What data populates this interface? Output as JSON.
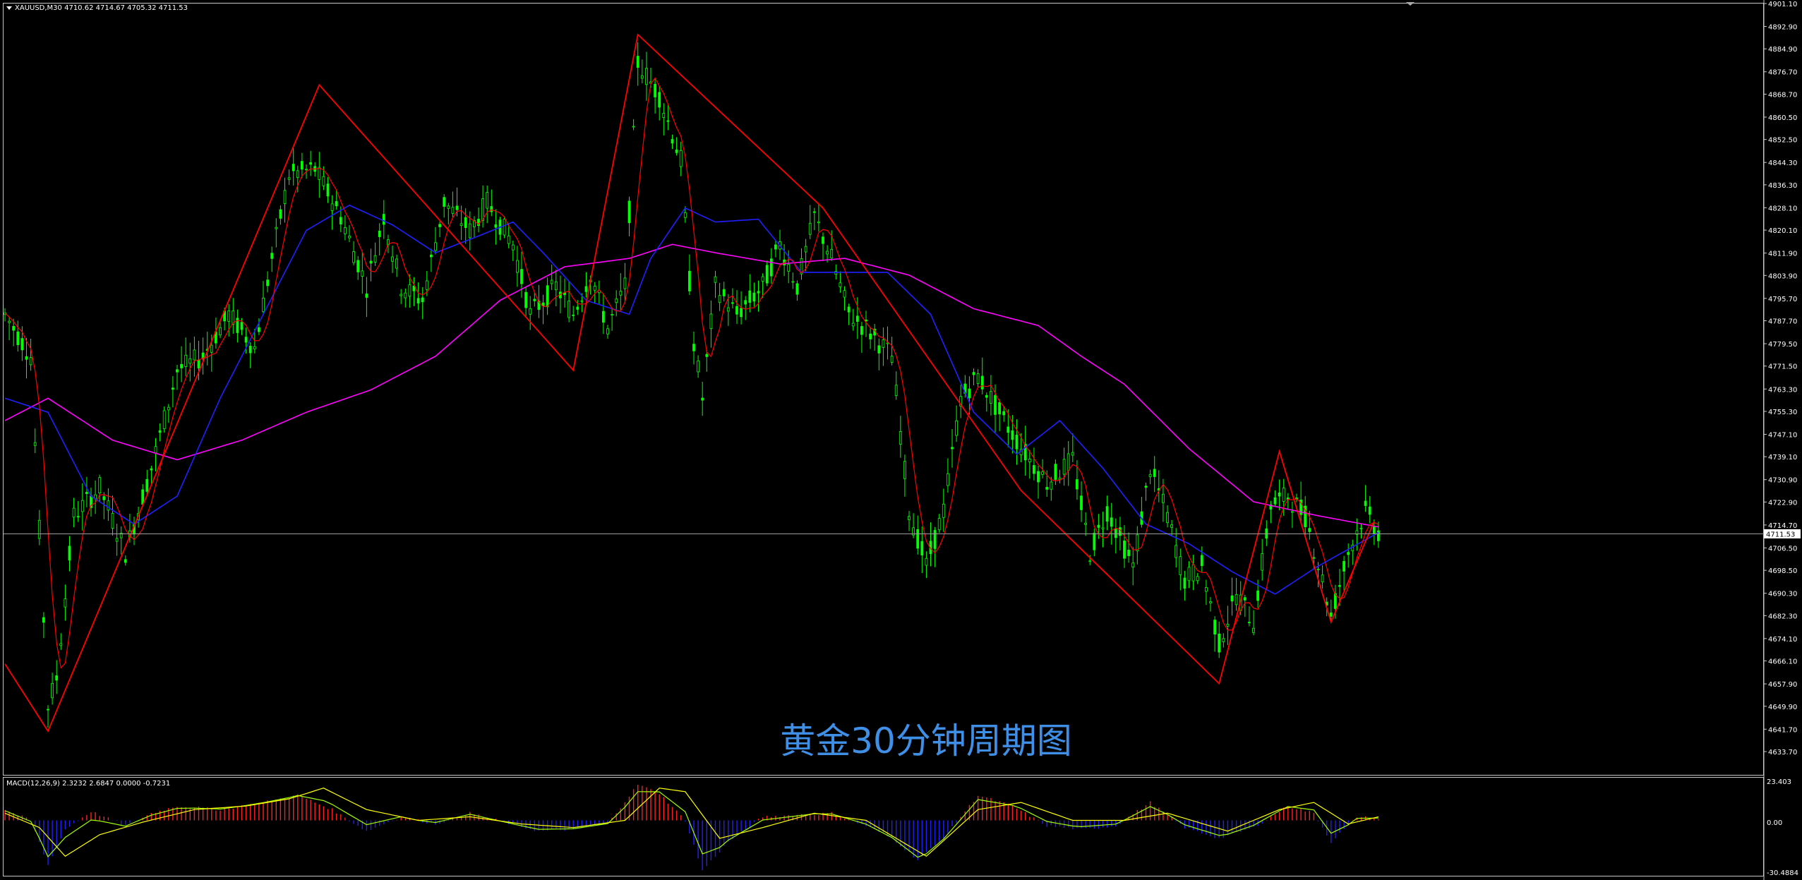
{
  "header": {
    "symbol_info": "XAUUSD,M30  4710.62 4714.67 4705.32 4711.53"
  },
  "caption": "黄金30分钟周期图",
  "current_price_label": "4711.53",
  "macd": {
    "label": "MACD(12,26,9) 2.3232 2.6847 0.0000 -0.7231",
    "axis_labels": [
      "23.403",
      "0.00",
      "-30.4884"
    ]
  },
  "colors": {
    "background": "#000000",
    "grid_frame": "#c8c8c8",
    "candle": "#00ff00",
    "ma_fast": "#ff0000",
    "ma_mid": "#2020ff",
    "ma_slow": "#ff00ff",
    "zigzag": "#ff0000",
    "macd_pos": "#ff2020",
    "macd_neg": "#2020ff",
    "macd_line": "#a0ff00",
    "macd_signal": "#ffff00",
    "caption": "#3f8fe6"
  },
  "chart_data": [
    {
      "type": "candlestick",
      "y_tick_labels": [
        "4901.10",
        "4892.90",
        "4884.90",
        "4876.70",
        "4868.70",
        "4860.50",
        "4852.50",
        "4844.30",
        "4836.30",
        "4828.10",
        "4820.10",
        "4811.90",
        "4803.90",
        "4795.70",
        "4787.70",
        "4779.50",
        "4771.50",
        "4763.30",
        "4755.30",
        "4747.10",
        "4739.10",
        "4730.90",
        "4722.90",
        "4714.70",
        "4706.50",
        "4698.50",
        "4690.30",
        "4682.30",
        "4674.10",
        "4666.10",
        "4657.90",
        "4649.90",
        "4641.70",
        "4633.70"
      ],
      "ylim": [
        4633.7,
        4901.1
      ],
      "current_price": 4711.53,
      "bars": 320,
      "zigzag": [
        {
          "i": 0,
          "p": 4665
        },
        {
          "i": 10,
          "p": 4641
        },
        {
          "i": 73,
          "p": 4872
        },
        {
          "i": 132,
          "p": 4770
        },
        {
          "i": 147,
          "p": 4890
        },
        {
          "i": 190,
          "p": 4828
        },
        {
          "i": 236,
          "p": 4727
        },
        {
          "i": 282,
          "p": 4658
        },
        {
          "i": 296,
          "p": 4741
        },
        {
          "i": 308,
          "p": 4680
        },
        {
          "i": 318,
          "p": 4716
        }
      ],
      "price_path": [
        {
          "i": 0,
          "p": 4790
        },
        {
          "i": 6,
          "p": 4775
        },
        {
          "i": 10,
          "p": 4650
        },
        {
          "i": 12,
          "p": 4660
        },
        {
          "i": 16,
          "p": 4718
        },
        {
          "i": 22,
          "p": 4728
        },
        {
          "i": 28,
          "p": 4705
        },
        {
          "i": 34,
          "p": 4735
        },
        {
          "i": 40,
          "p": 4770
        },
        {
          "i": 46,
          "p": 4775
        },
        {
          "i": 52,
          "p": 4790
        },
        {
          "i": 58,
          "p": 4778
        },
        {
          "i": 62,
          "p": 4810
        },
        {
          "i": 66,
          "p": 4840
        },
        {
          "i": 72,
          "p": 4842
        },
        {
          "i": 78,
          "p": 4825
        },
        {
          "i": 84,
          "p": 4800
        },
        {
          "i": 88,
          "p": 4825
        },
        {
          "i": 92,
          "p": 4800
        },
        {
          "i": 97,
          "p": 4795
        },
        {
          "i": 102,
          "p": 4830
        },
        {
          "i": 108,
          "p": 4820
        },
        {
          "i": 112,
          "p": 4830
        },
        {
          "i": 118,
          "p": 4815
        },
        {
          "i": 122,
          "p": 4790
        },
        {
          "i": 128,
          "p": 4800
        },
        {
          "i": 132,
          "p": 4790
        },
        {
          "i": 136,
          "p": 4805
        },
        {
          "i": 140,
          "p": 4785
        },
        {
          "i": 144,
          "p": 4800
        },
        {
          "i": 147,
          "p": 4880
        },
        {
          "i": 152,
          "p": 4868
        },
        {
          "i": 157,
          "p": 4845
        },
        {
          "i": 160,
          "p": 4780
        },
        {
          "i": 162,
          "p": 4760
        },
        {
          "i": 165,
          "p": 4800
        },
        {
          "i": 170,
          "p": 4790
        },
        {
          "i": 176,
          "p": 4800
        },
        {
          "i": 180,
          "p": 4815
        },
        {
          "i": 184,
          "p": 4800
        },
        {
          "i": 188,
          "p": 4825
        },
        {
          "i": 192,
          "p": 4810
        },
        {
          "i": 196,
          "p": 4790
        },
        {
          "i": 200,
          "p": 4785
        },
        {
          "i": 206,
          "p": 4775
        },
        {
          "i": 210,
          "p": 4720
        },
        {
          "i": 214,
          "p": 4700
        },
        {
          "i": 218,
          "p": 4720
        },
        {
          "i": 222,
          "p": 4760
        },
        {
          "i": 226,
          "p": 4768
        },
        {
          "i": 232,
          "p": 4752
        },
        {
          "i": 238,
          "p": 4738
        },
        {
          "i": 242,
          "p": 4730
        },
        {
          "i": 248,
          "p": 4738
        },
        {
          "i": 252,
          "p": 4705
        },
        {
          "i": 256,
          "p": 4720
        },
        {
          "i": 262,
          "p": 4700
        },
        {
          "i": 266,
          "p": 4735
        },
        {
          "i": 270,
          "p": 4718
        },
        {
          "i": 274,
          "p": 4695
        },
        {
          "i": 278,
          "p": 4700
        },
        {
          "i": 282,
          "p": 4672
        },
        {
          "i": 286,
          "p": 4690
        },
        {
          "i": 290,
          "p": 4680
        },
        {
          "i": 294,
          "p": 4722
        },
        {
          "i": 298,
          "p": 4725
        },
        {
          "i": 302,
          "p": 4718
        },
        {
          "i": 306,
          "p": 4695
        },
        {
          "i": 308,
          "p": 4682
        },
        {
          "i": 312,
          "p": 4705
        },
        {
          "i": 316,
          "p": 4720
        },
        {
          "i": 319,
          "p": 4712
        }
      ],
      "ma_mid": [
        {
          "i": 0,
          "p": 4760
        },
        {
          "i": 10,
          "p": 4755
        },
        {
          "i": 20,
          "p": 4725
        },
        {
          "i": 30,
          "p": 4715
        },
        {
          "i": 40,
          "p": 4725
        },
        {
          "i": 50,
          "p": 4760
        },
        {
          "i": 60,
          "p": 4790
        },
        {
          "i": 70,
          "p": 4820
        },
        {
          "i": 80,
          "p": 4829
        },
        {
          "i": 90,
          "p": 4822
        },
        {
          "i": 100,
          "p": 4812
        },
        {
          "i": 110,
          "p": 4818
        },
        {
          "i": 118,
          "p": 4823
        },
        {
          "i": 125,
          "p": 4812
        },
        {
          "i": 135,
          "p": 4795
        },
        {
          "i": 145,
          "p": 4790
        },
        {
          "i": 150,
          "p": 4810
        },
        {
          "i": 158,
          "p": 4828
        },
        {
          "i": 165,
          "p": 4823
        },
        {
          "i": 175,
          "p": 4824
        },
        {
          "i": 185,
          "p": 4805
        },
        {
          "i": 195,
          "p": 4805
        },
        {
          "i": 205,
          "p": 4805
        },
        {
          "i": 215,
          "p": 4790
        },
        {
          "i": 225,
          "p": 4755
        },
        {
          "i": 235,
          "p": 4740
        },
        {
          "i": 245,
          "p": 4752
        },
        {
          "i": 255,
          "p": 4735
        },
        {
          "i": 265,
          "p": 4715
        },
        {
          "i": 275,
          "p": 4708
        },
        {
          "i": 285,
          "p": 4698
        },
        {
          "i": 295,
          "p": 4690
        },
        {
          "i": 305,
          "p": 4700
        },
        {
          "i": 319,
          "p": 4712
        }
      ],
      "ma_slow": [
        {
          "i": 0,
          "p": 4752
        },
        {
          "i": 10,
          "p": 4760
        },
        {
          "i": 25,
          "p": 4745
        },
        {
          "i": 40,
          "p": 4738
        },
        {
          "i": 55,
          "p": 4745
        },
        {
          "i": 70,
          "p": 4755
        },
        {
          "i": 85,
          "p": 4763
        },
        {
          "i": 100,
          "p": 4775
        },
        {
          "i": 115,
          "p": 4795
        },
        {
          "i": 130,
          "p": 4807
        },
        {
          "i": 145,
          "p": 4810
        },
        {
          "i": 155,
          "p": 4815
        },
        {
          "i": 165,
          "p": 4812
        },
        {
          "i": 180,
          "p": 4808
        },
        {
          "i": 195,
          "p": 4810
        },
        {
          "i": 210,
          "p": 4804
        },
        {
          "i": 225,
          "p": 4792
        },
        {
          "i": 240,
          "p": 4786
        },
        {
          "i": 250,
          "p": 4775
        },
        {
          "i": 260,
          "p": 4765
        },
        {
          "i": 275,
          "p": 4742
        },
        {
          "i": 290,
          "p": 4723
        },
        {
          "i": 305,
          "p": 4718
        },
        {
          "i": 319,
          "p": 4714
        }
      ]
    },
    {
      "type": "bar",
      "name": "MACD(12,26,9)",
      "ylim": [
        -30.4884,
        23.403
      ],
      "hist_path": [
        {
          "i": 0,
          "p": 6
        },
        {
          "i": 6,
          "p": 0
        },
        {
          "i": 10,
          "p": -25
        },
        {
          "i": 14,
          "p": -5
        },
        {
          "i": 20,
          "p": 5
        },
        {
          "i": 28,
          "p": -3
        },
        {
          "i": 34,
          "p": 4
        },
        {
          "i": 40,
          "p": 8
        },
        {
          "i": 50,
          "p": 6
        },
        {
          "i": 60,
          "p": 10
        },
        {
          "i": 68,
          "p": 14
        },
        {
          "i": 76,
          "p": 6
        },
        {
          "i": 84,
          "p": -6
        },
        {
          "i": 92,
          "p": 2
        },
        {
          "i": 100,
          "p": -2
        },
        {
          "i": 108,
          "p": 4
        },
        {
          "i": 116,
          "p": -1
        },
        {
          "i": 124,
          "p": -6
        },
        {
          "i": 132,
          "p": -5
        },
        {
          "i": 140,
          "p": -2
        },
        {
          "i": 147,
          "p": 20
        },
        {
          "i": 152,
          "p": 15
        },
        {
          "i": 158,
          "p": 0
        },
        {
          "i": 162,
          "p": -28
        },
        {
          "i": 168,
          "p": -12
        },
        {
          "i": 176,
          "p": 2
        },
        {
          "i": 184,
          "p": 3
        },
        {
          "i": 192,
          "p": 4
        },
        {
          "i": 200,
          "p": -3
        },
        {
          "i": 206,
          "p": -10
        },
        {
          "i": 212,
          "p": -22
        },
        {
          "i": 218,
          "p": -10
        },
        {
          "i": 226,
          "p": 14
        },
        {
          "i": 234,
          "p": 8
        },
        {
          "i": 242,
          "p": -3
        },
        {
          "i": 250,
          "p": -5
        },
        {
          "i": 258,
          "p": -3
        },
        {
          "i": 266,
          "p": 10
        },
        {
          "i": 274,
          "p": -4
        },
        {
          "i": 282,
          "p": -10
        },
        {
          "i": 290,
          "p": -4
        },
        {
          "i": 298,
          "p": 8
        },
        {
          "i": 304,
          "p": 4
        },
        {
          "i": 308,
          "p": -12
        },
        {
          "i": 314,
          "p": 2
        },
        {
          "i": 319,
          "p": 1
        }
      ],
      "signal_path": [
        {
          "i": 0,
          "p": 4
        },
        {
          "i": 8,
          "p": -4
        },
        {
          "i": 14,
          "p": -20
        },
        {
          "i": 22,
          "p": -8
        },
        {
          "i": 32,
          "p": -1
        },
        {
          "i": 44,
          "p": 6
        },
        {
          "i": 56,
          "p": 8
        },
        {
          "i": 66,
          "p": 12
        },
        {
          "i": 74,
          "p": 18
        },
        {
          "i": 84,
          "p": 6
        },
        {
          "i": 96,
          "p": 0
        },
        {
          "i": 108,
          "p": 2
        },
        {
          "i": 120,
          "p": -2
        },
        {
          "i": 132,
          "p": -4
        },
        {
          "i": 144,
          "p": 0
        },
        {
          "i": 152,
          "p": 18
        },
        {
          "i": 158,
          "p": 16
        },
        {
          "i": 166,
          "p": -10
        },
        {
          "i": 176,
          "p": -4
        },
        {
          "i": 188,
          "p": 4
        },
        {
          "i": 200,
          "p": 0
        },
        {
          "i": 214,
          "p": -20
        },
        {
          "i": 226,
          "p": 6
        },
        {
          "i": 236,
          "p": 10
        },
        {
          "i": 248,
          "p": 0
        },
        {
          "i": 260,
          "p": 0
        },
        {
          "i": 270,
          "p": 4
        },
        {
          "i": 284,
          "p": -6
        },
        {
          "i": 296,
          "p": 6
        },
        {
          "i": 304,
          "p": 10
        },
        {
          "i": 312,
          "p": -2
        },
        {
          "i": 319,
          "p": 2
        }
      ]
    }
  ]
}
